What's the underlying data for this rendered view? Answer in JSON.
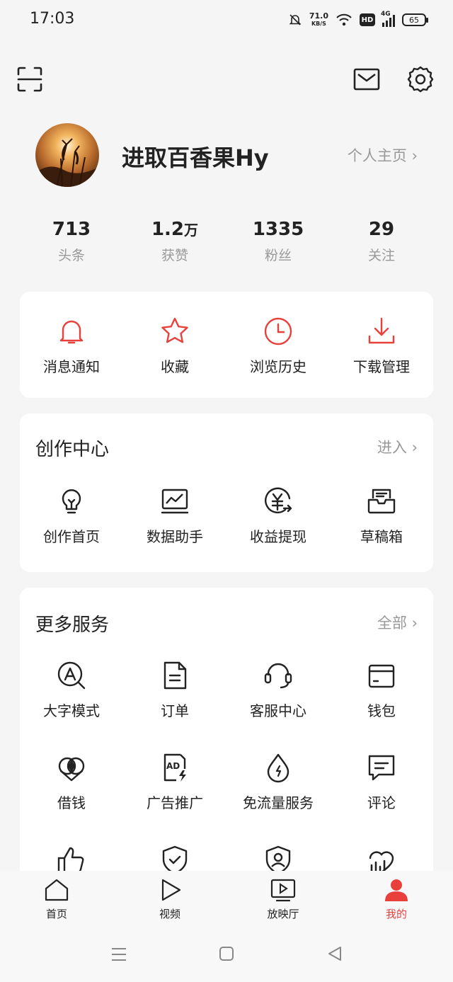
{
  "status_bar": {
    "time": "17:03",
    "net_speed": "71.0",
    "net_unit": "KB/S",
    "hd": "HD",
    "signal": "4G",
    "battery": "65"
  },
  "profile": {
    "name": "进取百香果Hy",
    "homepage_link": "个人主页"
  },
  "stats": [
    {
      "value": "713",
      "unit": "",
      "label": "头条"
    },
    {
      "value": "1.2",
      "unit": "万",
      "label": "获赞"
    },
    {
      "value": "1335",
      "unit": "",
      "label": "粉丝"
    },
    {
      "value": "29",
      "unit": "",
      "label": "关注"
    }
  ],
  "quick_actions": [
    {
      "label": "消息通知",
      "icon": "bell-icon"
    },
    {
      "label": "收藏",
      "icon": "star-icon"
    },
    {
      "label": "浏览历史",
      "icon": "clock-icon"
    },
    {
      "label": "下载管理",
      "icon": "download-icon"
    }
  ],
  "creator_center": {
    "title": "创作中心",
    "link": "进入",
    "items": [
      {
        "label": "创作首页",
        "icon": "lightbulb-icon"
      },
      {
        "label": "数据助手",
        "icon": "chart-monitor-icon"
      },
      {
        "label": "收益提现",
        "icon": "yuan-withdraw-icon"
      },
      {
        "label": "草稿箱",
        "icon": "draft-box-icon"
      }
    ]
  },
  "more_services": {
    "title": "更多服务",
    "link": "全部",
    "items": [
      {
        "label": "大字模式",
        "icon": "large-font-icon"
      },
      {
        "label": "订单",
        "icon": "order-doc-icon"
      },
      {
        "label": "客服中心",
        "icon": "headset-icon"
      },
      {
        "label": "钱包",
        "icon": "wallet-icon"
      },
      {
        "label": "借钱",
        "icon": "loan-icon"
      },
      {
        "label": "广告推广",
        "icon": "ad-icon"
      },
      {
        "label": "免流量服务",
        "icon": "data-drop-icon"
      },
      {
        "label": "评论",
        "icon": "comment-icon"
      },
      {
        "label": "",
        "icon": "thumbs-up-icon"
      },
      {
        "label": "",
        "icon": "shield-check-icon"
      },
      {
        "label": "",
        "icon": "shield-user-icon"
      },
      {
        "label": "",
        "icon": "signal-heart-icon"
      }
    ]
  },
  "tab_bar": [
    {
      "label": "首页",
      "icon": "home-icon"
    },
    {
      "label": "视频",
      "icon": "play-icon"
    },
    {
      "label": "放映厅",
      "icon": "tv-play-icon"
    },
    {
      "label": "我的",
      "icon": "person-icon",
      "active": true
    }
  ],
  "colors": {
    "accent": "#e8413c",
    "text": "#222222",
    "muted": "#999999",
    "background": "#f5f5f5",
    "card": "#ffffff"
  }
}
